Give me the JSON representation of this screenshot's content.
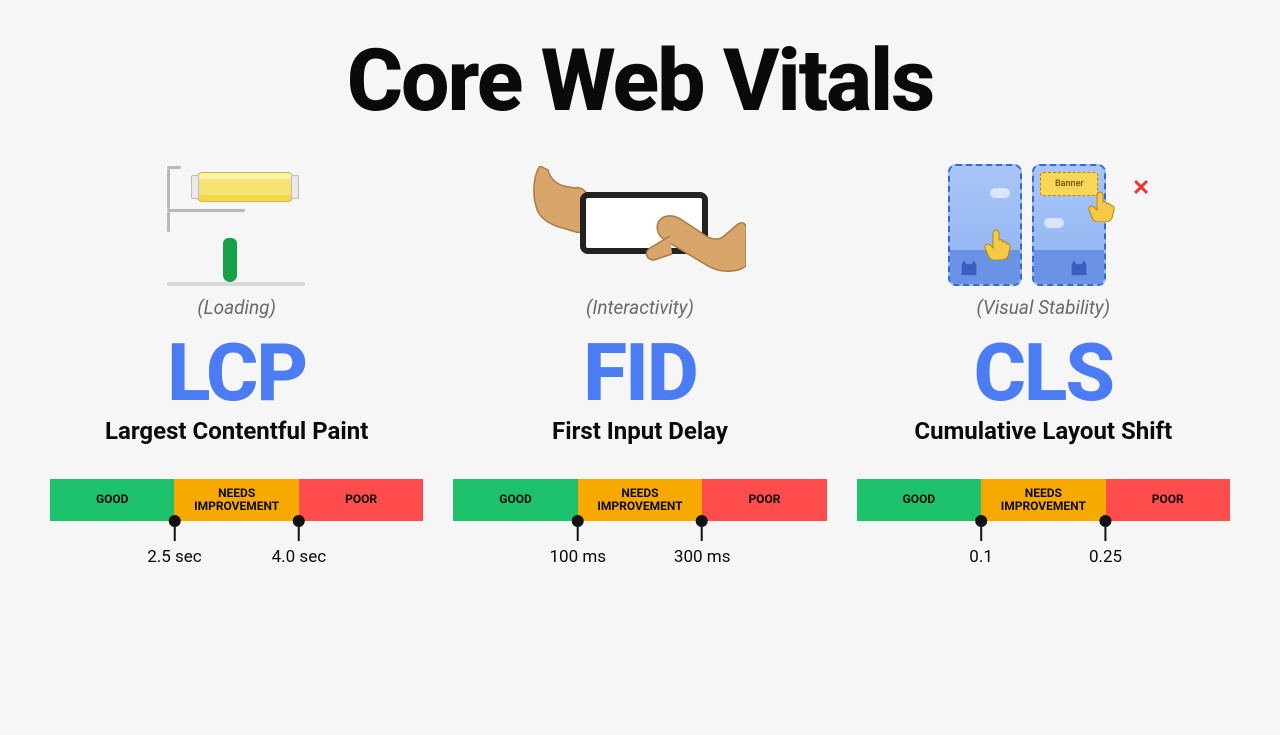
{
  "title": "Core Web Vitals",
  "legend": {
    "good": "GOOD",
    "needs": "NEEDS IMPROVEMENT",
    "poor": "POOR"
  },
  "metrics": [
    {
      "category": "(Loading)",
      "acronym": "LCP",
      "fullname": "Largest Contentful Paint",
      "threshold_low": "2.5 sec",
      "threshold_high": "4.0 sec",
      "icon": "paint-roller-icon"
    },
    {
      "category": "(Interactivity)",
      "acronym": "FID",
      "fullname": "First Input Delay",
      "threshold_low": "100 ms",
      "threshold_high": "300 ms",
      "icon": "hands-phone-icon"
    },
    {
      "category": "(Visual Stability)",
      "acronym": "CLS",
      "fullname": "Cumulative Layout Shift",
      "threshold_low": "0.1",
      "threshold_high": "0.25",
      "icon": "layout-shift-icon",
      "banner_label": "Banner"
    }
  ]
}
